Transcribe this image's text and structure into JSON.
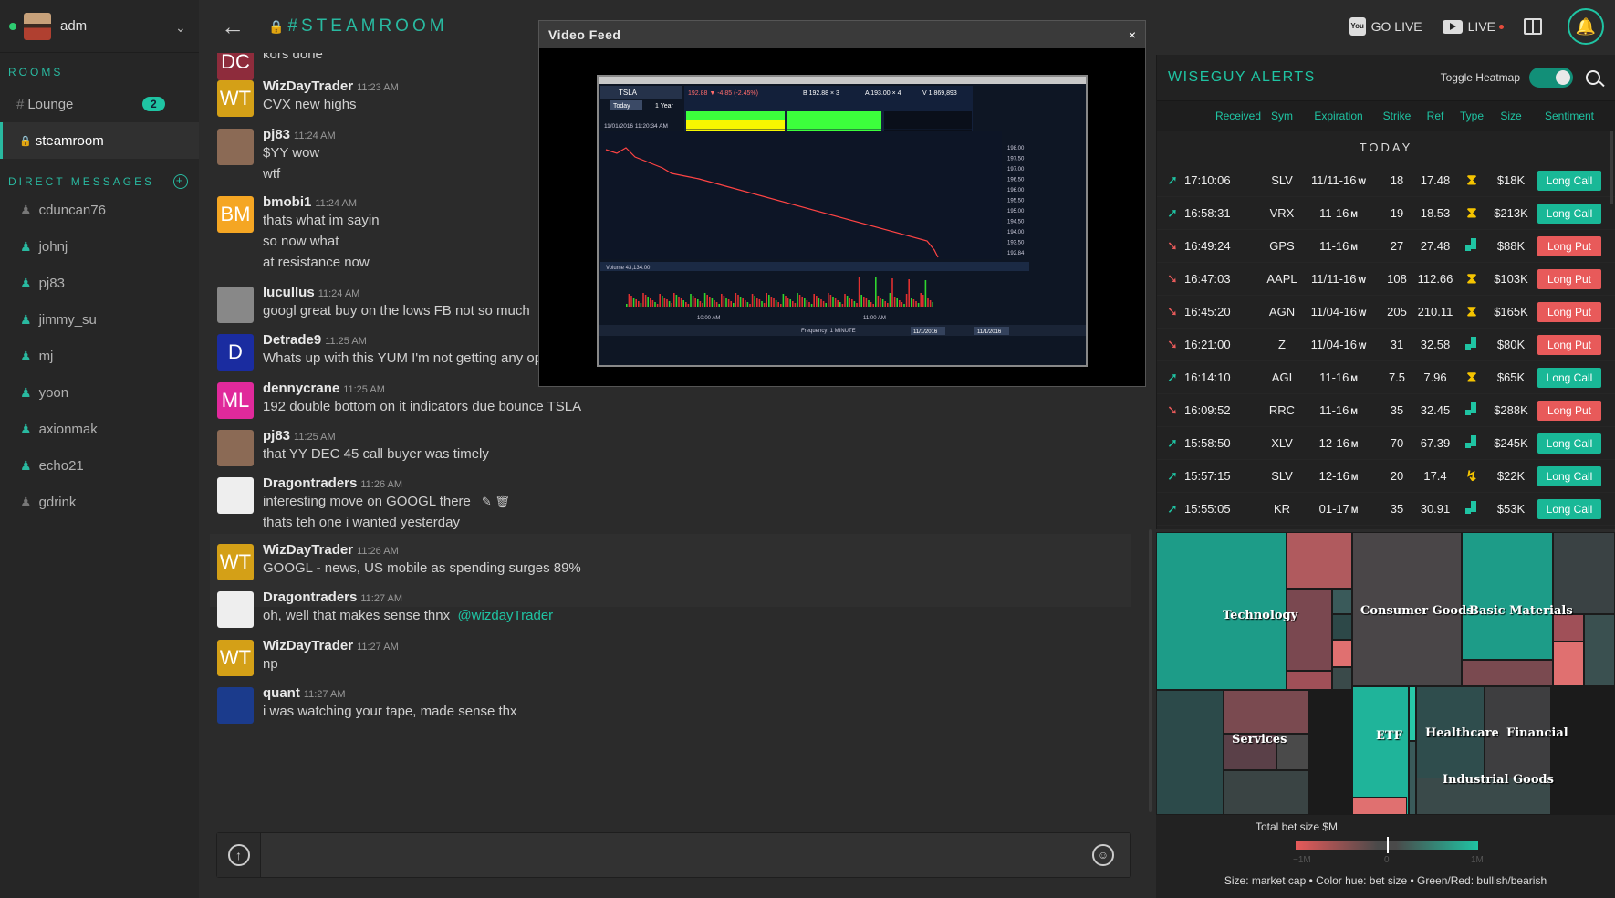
{
  "user": {
    "name": "adm"
  },
  "sidebar": {
    "rooms_label": "ROOMS",
    "rooms": [
      {
        "name": "Lounge",
        "badge": "2"
      },
      {
        "name": "steamroom"
      }
    ],
    "dm_label": "DIRECT MESSAGES",
    "dms": [
      {
        "name": "cduncan76",
        "online": false
      },
      {
        "name": "johnj",
        "online": true
      },
      {
        "name": "pj83",
        "online": true
      },
      {
        "name": "jimmy_su",
        "online": true
      },
      {
        "name": "mj",
        "online": true
      },
      {
        "name": "yoon",
        "online": true
      },
      {
        "name": "axionmak",
        "online": true
      },
      {
        "name": "echo21",
        "online": true
      },
      {
        "name": "gdrink",
        "online": false
      }
    ]
  },
  "chat": {
    "room_title": "#STEAMROOM",
    "messages": [
      {
        "user": "",
        "time": "",
        "lines": [
          "kors done"
        ],
        "avatar_text": "DC",
        "avatar_color": "#8e2c3c"
      },
      {
        "user": "WizDayTrader",
        "time": "11:23 AM",
        "lines": [
          "CVX new highs"
        ],
        "avatar_text": "WT",
        "avatar_color": "#d4a017"
      },
      {
        "user": "pj83",
        "time": "11:24 AM",
        "lines": [
          "$YY wow",
          "wtf"
        ],
        "avatar_text": "",
        "avatar_color": "#8b6a55"
      },
      {
        "user": "bmobi1",
        "time": "11:24 AM",
        "lines": [
          "thats what im sayin",
          "so now what",
          "at resistance now"
        ],
        "avatar_text": "BM",
        "avatar_color": "#f5a623"
      },
      {
        "user": "lucullus",
        "time": "11:24 AM",
        "lines": [
          "googl great buy on the lows FB not so much"
        ],
        "avatar_text": "",
        "avatar_color": "#888"
      },
      {
        "user": "Detrade9",
        "time": "11:25 AM",
        "lines": [
          "Whats up with this YUM I'm not getting any options chains for it ."
        ],
        "avatar_text": "D",
        "avatar_color": "#1a2ca0"
      },
      {
        "user": "dennycrane",
        "time": "11:25 AM",
        "lines": [
          "192 double bottom on it indicators due bounce TSLA"
        ],
        "avatar_text": "ML",
        "avatar_color": "#e0299b"
      },
      {
        "user": "pj83",
        "time": "11:25 AM",
        "lines": [
          "that YY DEC 45 call buyer was timely"
        ],
        "avatar_text": "",
        "avatar_color": "#8b6a55"
      },
      {
        "user": "Dragontraders",
        "time": "11:26 AM",
        "lines": [
          "interesting move on GOOGL there",
          "thats teh one i wanted yesterday"
        ],
        "avatar_text": "",
        "avatar_color": "#eee"
      },
      {
        "user": "WizDayTrader",
        "time": "11:26 AM",
        "lines": [
          "GOOGL - news, US mobile as spending surges 89%"
        ],
        "avatar_text": "WT",
        "avatar_color": "#d4a017"
      },
      {
        "user": "Dragontraders",
        "time": "11:27 AM",
        "lines": [
          "oh, well that makes sense thnx"
        ],
        "mention": "@wizdayTrader",
        "avatar_text": "",
        "avatar_color": "#eee"
      },
      {
        "user": "WizDayTrader",
        "time": "11:27 AM",
        "lines": [
          "np"
        ],
        "avatar_text": "WT",
        "avatar_color": "#d4a017"
      },
      {
        "user": "quant",
        "time": "11:27 AM",
        "lines": [
          "i was watching your tape, made sense thx"
        ],
        "avatar_text": "",
        "avatar_color": "#1b3b8c"
      }
    ]
  },
  "video": {
    "title": "Video Feed",
    "close": "×",
    "screen": {
      "symbol": "TSLA",
      "quote": "192.88 ▼ -4.85 (-2.45%)",
      "bid": "B 192.88 × 3",
      "ask": "A 193.00 × 4",
      "volume": "V 1,869,893",
      "range_today": "Today",
      "range_year": "1 Year",
      "timestamp": "11/01/2016 11:20:34 AM",
      "volume_label": "Volume 43,134.00",
      "axis_times": [
        "10:00 AM",
        "11:00 AM"
      ],
      "date_from": "11/1/2016",
      "date_to": "11/1/2016",
      "frequency": "Frequency: 1 MINUTE",
      "price_ticks": [
        "198.00",
        "197.50",
        "197.00",
        "196.50",
        "196.00",
        "195.50",
        "195.00",
        "194.50",
        "194.00",
        "193.50",
        "192.84"
      ]
    }
  },
  "toolbar": {
    "go_live": "GO LIVE",
    "live": "LIVE"
  },
  "alerts": {
    "title": "WISEGUY ALERTS",
    "toggle_label": "Toggle Heatmap",
    "columns": [
      "Received",
      "Sym",
      "Expiration",
      "Strike",
      "Ref",
      "Type",
      "Size",
      "Sentiment"
    ],
    "today_label": "TODAY",
    "rows": [
      {
        "dir": "up",
        "time": "17:10:06",
        "sym": "SLV",
        "exp": "11/11-16",
        "exp_sfx": "W",
        "strike": "18",
        "ref": "17.48",
        "type": "bolt2",
        "size": "$18K",
        "sentiment": "Long Call"
      },
      {
        "dir": "up",
        "time": "16:58:31",
        "sym": "VRX",
        "exp": "11-16",
        "exp_sfx": "M",
        "strike": "19",
        "ref": "18.53",
        "type": "bolt2",
        "size": "$213K",
        "sentiment": "Long Call"
      },
      {
        "dir": "down",
        "time": "16:49:24",
        "sym": "GPS",
        "exp": "11-16",
        "exp_sfx": "M",
        "strike": "27",
        "ref": "27.48",
        "type": "blocks",
        "size": "$88K",
        "sentiment": "Long Put"
      },
      {
        "dir": "down",
        "time": "16:47:03",
        "sym": "AAPL",
        "exp": "11/11-16",
        "exp_sfx": "W",
        "strike": "108",
        "ref": "112.66",
        "type": "bolt2",
        "size": "$103K",
        "sentiment": "Long Put"
      },
      {
        "dir": "down",
        "time": "16:45:20",
        "sym": "AGN",
        "exp": "11/04-16",
        "exp_sfx": "W",
        "strike": "205",
        "ref": "210.11",
        "type": "bolt2",
        "size": "$165K",
        "sentiment": "Long Put"
      },
      {
        "dir": "down",
        "time": "16:21:00",
        "sym": "Z",
        "exp": "11/04-16",
        "exp_sfx": "W",
        "strike": "31",
        "ref": "32.58",
        "type": "blocks",
        "size": "$80K",
        "sentiment": "Long Put"
      },
      {
        "dir": "up",
        "time": "16:14:10",
        "sym": "AGI",
        "exp": "11-16",
        "exp_sfx": "M",
        "strike": "7.5",
        "ref": "7.96",
        "type": "bolt2",
        "size": "$65K",
        "sentiment": "Long Call"
      },
      {
        "dir": "down",
        "time": "16:09:52",
        "sym": "RRC",
        "exp": "11-16",
        "exp_sfx": "M",
        "strike": "35",
        "ref": "32.45",
        "type": "blocks",
        "size": "$288K",
        "sentiment": "Long Put"
      },
      {
        "dir": "up",
        "time": "15:58:50",
        "sym": "XLV",
        "exp": "12-16",
        "exp_sfx": "M",
        "strike": "70",
        "ref": "67.39",
        "type": "blocks",
        "size": "$245K",
        "sentiment": "Long Call"
      },
      {
        "dir": "up",
        "time": "15:57:15",
        "sym": "SLV",
        "exp": "12-16",
        "exp_sfx": "M",
        "strike": "20",
        "ref": "17.4",
        "type": "bolt1",
        "size": "$22K",
        "sentiment": "Long Call"
      },
      {
        "dir": "up",
        "time": "15:55:05",
        "sym": "KR",
        "exp": "01-17",
        "exp_sfx": "M",
        "strike": "35",
        "ref": "30.91",
        "type": "blocks",
        "size": "$53K",
        "sentiment": "Long Call"
      }
    ]
  },
  "heatmap": {
    "sectors": [
      "Technology",
      "Consumer Goods",
      "Basic Materials",
      "Services",
      "ETF",
      "Healthcare",
      "Financial",
      "Industrial Goods"
    ],
    "legend_title": "Total bet size $M",
    "legend_min": "−1M",
    "legend_mid": "0",
    "legend_max": "1M",
    "footer": "Size: market cap • Color hue: bet size • Green/Red: bullish/bearish"
  }
}
